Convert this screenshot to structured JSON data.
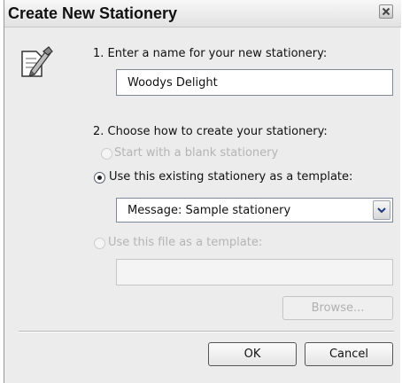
{
  "dialog": {
    "title": "Create New Stationery",
    "step1_label": "1. Enter a name for your new stationery:",
    "name_value": "Woodys Delight",
    "step2_label": "2. Choose how to create your stationery:",
    "option_blank": "Start with a blank stationery",
    "option_existing": "Use this existing stationery as a template:",
    "existing_selected": "Message: Sample stationery",
    "option_file": "Use this file as a template:",
    "file_value": "",
    "browse_label": "Browse...",
    "ok_label": "OK",
    "cancel_label": "Cancel",
    "selected_option": "existing",
    "icons": {
      "close": "close-icon",
      "app": "stationery-icon",
      "dropdown": "chevron-down-icon"
    }
  }
}
